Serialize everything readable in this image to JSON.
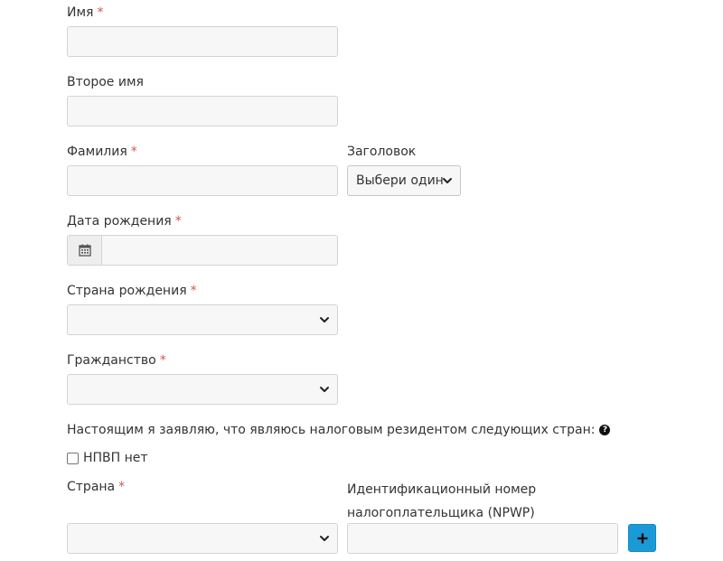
{
  "form": {
    "first_name": {
      "label": "Имя",
      "required_mark": "*",
      "value": ""
    },
    "middle_name": {
      "label": "Второе имя",
      "value": ""
    },
    "last_name": {
      "label": "Фамилия",
      "required_mark": "*",
      "value": ""
    },
    "title": {
      "label": "Заголовок",
      "selected": "Выбери один"
    },
    "birth_date": {
      "label": "Дата рождения",
      "required_mark": "*",
      "value": ""
    },
    "birth_country": {
      "label": "Страна рождения",
      "required_mark": "*",
      "selected": ""
    },
    "citizenship": {
      "label": "Гражданство",
      "required_mark": "*",
      "selected": ""
    },
    "tax_declaration": {
      "text": "Настоящим я заявляю, что являюсь налоговым резидентом следующих стран:",
      "help_icon": "question-circle-icon"
    },
    "no_npwp": {
      "label": "НПВП нет",
      "checked": false
    },
    "country": {
      "label": "Страна",
      "required_mark": "*",
      "selected": ""
    },
    "tax_id": {
      "label_line1": "Идентификационный номер",
      "label_line2": "налогоплательщика (NPWP)",
      "value": ""
    },
    "add_button": {
      "icon": "plus-icon"
    }
  },
  "colors": {
    "required": "#d9534f",
    "input_bg": "#f7f7f7",
    "input_border": "#d3d3d3",
    "add_button": "#1a9bd7"
  }
}
